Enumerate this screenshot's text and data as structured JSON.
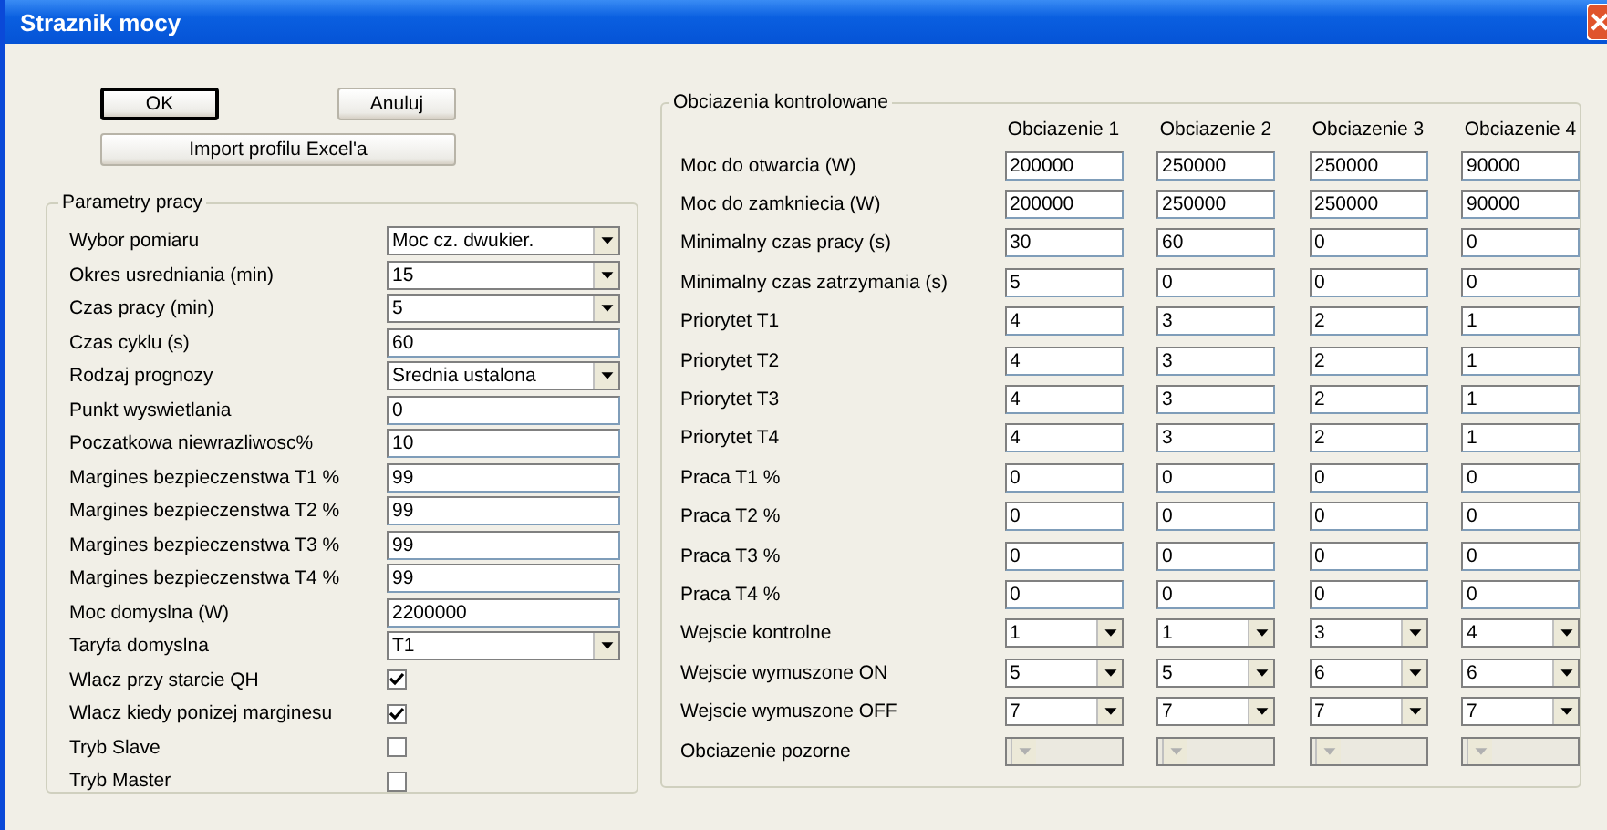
{
  "window": {
    "title": "Straznik mocy"
  },
  "buttons": [
    {
      "label": "OK",
      "kind": "default"
    },
    {
      "label": "Anuluj",
      "kind": "normal"
    },
    {
      "label": "Import profilu Excel'a",
      "kind": "wide"
    }
  ],
  "parameters": {
    "title": "Parametry pracy",
    "rows": [
      {
        "label": "Wybor pomiaru",
        "kind": "select",
        "value": "Moc cz. dwukier."
      },
      {
        "label": "Okres usredniania (min)",
        "kind": "select",
        "value": "15"
      },
      {
        "label": "Czas pracy (min)",
        "kind": "select",
        "value": "5"
      },
      {
        "label": "Czas cyklu (s)",
        "kind": "text",
        "value": "60"
      },
      {
        "label": "Rodzaj prognozy",
        "kind": "select",
        "value": "Srednia ustalona"
      },
      {
        "label": "Punkt wyswietlania",
        "kind": "text",
        "value": "0"
      },
      {
        "label": "Poczatkowa niewrazliwosc%",
        "kind": "text",
        "value": "10"
      },
      {
        "label": "Margines bezpieczenstwa T1 %",
        "kind": "text",
        "value": "99"
      },
      {
        "label": "Margines bezpieczenstwa T2 %",
        "kind": "text",
        "value": "99"
      },
      {
        "label": "Margines bezpieczenstwa T3 %",
        "kind": "text",
        "value": "99"
      },
      {
        "label": "Margines bezpieczenstwa T4 %",
        "kind": "text",
        "value": "99"
      },
      {
        "label": "Moc domyslna (W)",
        "kind": "text",
        "value": "2200000"
      },
      {
        "label": "Taryfa domyslna",
        "kind": "select",
        "value": "T1"
      },
      {
        "label": "Wlacz przy starcie QH",
        "kind": "checkbox",
        "checked": true
      },
      {
        "label": "Wlacz kiedy ponizej marginesu",
        "kind": "checkbox",
        "checked": true
      },
      {
        "label": "Tryb Slave",
        "kind": "checkbox",
        "checked": false
      },
      {
        "label": "Tryb Master",
        "kind": "checkbox",
        "checked": false
      }
    ]
  },
  "loads": {
    "title": "Obciazenia kontrolowane",
    "columns": [
      "Obciazenie 1",
      "Obciazenie 2",
      "Obciazenie 3",
      "Obciazenie 4"
    ],
    "rows": [
      {
        "label": "Moc do otwarcia (W)",
        "kind": "text",
        "cells": [
          {
            "value": "200000"
          },
          {
            "value": "250000"
          },
          {
            "value": "250000"
          },
          {
            "value": "90000"
          }
        ]
      },
      {
        "label": "Moc do zamkniecia (W)",
        "kind": "text",
        "cells": [
          {
            "value": "200000"
          },
          {
            "value": "250000"
          },
          {
            "value": "250000"
          },
          {
            "value": "90000"
          }
        ]
      },
      {
        "label": "Minimalny czas pracy (s)",
        "kind": "text",
        "cells": [
          {
            "value": "30"
          },
          {
            "value": "60"
          },
          {
            "value": "0"
          },
          {
            "value": "0"
          }
        ]
      },
      {
        "label": "Minimalny czas zatrzymania (s)",
        "kind": "text",
        "cells": [
          {
            "value": "5"
          },
          {
            "value": "0"
          },
          {
            "value": "0"
          },
          {
            "value": "0"
          }
        ]
      },
      {
        "label": "Priorytet T1",
        "kind": "text",
        "cells": [
          {
            "value": "4"
          },
          {
            "value": "3"
          },
          {
            "value": "2"
          },
          {
            "value": "1"
          }
        ]
      },
      {
        "label": "Priorytet T2",
        "kind": "text",
        "cells": [
          {
            "value": "4"
          },
          {
            "value": "3"
          },
          {
            "value": "2"
          },
          {
            "value": "1"
          }
        ]
      },
      {
        "label": "Priorytet T3",
        "kind": "text",
        "cells": [
          {
            "value": "4"
          },
          {
            "value": "3"
          },
          {
            "value": "2"
          },
          {
            "value": "1"
          }
        ]
      },
      {
        "label": "Priorytet T4",
        "kind": "text",
        "cells": [
          {
            "value": "4"
          },
          {
            "value": "3"
          },
          {
            "value": "2"
          },
          {
            "value": "1"
          }
        ]
      },
      {
        "label": "Praca T1 %",
        "kind": "text",
        "cells": [
          {
            "value": "0"
          },
          {
            "value": "0"
          },
          {
            "value": "0"
          },
          {
            "value": "0"
          }
        ]
      },
      {
        "label": "Praca T2 %",
        "kind": "text",
        "cells": [
          {
            "value": "0"
          },
          {
            "value": "0"
          },
          {
            "value": "0"
          },
          {
            "value": "0"
          }
        ]
      },
      {
        "label": "Praca T3 %",
        "kind": "text",
        "cells": [
          {
            "value": "0"
          },
          {
            "value": "0"
          },
          {
            "value": "0"
          },
          {
            "value": "0"
          }
        ]
      },
      {
        "label": "Praca T4 %",
        "kind": "text",
        "cells": [
          {
            "value": "0"
          },
          {
            "value": "0"
          },
          {
            "value": "0"
          },
          {
            "value": "0"
          }
        ]
      },
      {
        "label": "Wejscie kontrolne",
        "kind": "select",
        "cells": [
          {
            "value": "1",
            "disabled": false
          },
          {
            "value": "1",
            "disabled": false
          },
          {
            "value": "3",
            "disabled": false
          },
          {
            "value": "4",
            "disabled": false
          }
        ]
      },
      {
        "label": "Wejscie wymuszone ON",
        "kind": "select",
        "cells": [
          {
            "value": "5",
            "disabled": false
          },
          {
            "value": "5",
            "disabled": false
          },
          {
            "value": "6",
            "disabled": false
          },
          {
            "value": "6",
            "disabled": false
          }
        ]
      },
      {
        "label": "Wejscie wymuszone OFF",
        "kind": "select",
        "cells": [
          {
            "value": "7",
            "disabled": false
          },
          {
            "value": "7",
            "disabled": false
          },
          {
            "value": "7",
            "disabled": false
          },
          {
            "value": "7",
            "disabled": false
          }
        ]
      },
      {
        "label": "Obciazenie pozorne",
        "kind": "select",
        "cells": [
          {
            "disabled": true
          },
          {
            "disabled": true
          },
          {
            "disabled": true
          },
          {
            "disabled": true
          }
        ]
      }
    ]
  }
}
